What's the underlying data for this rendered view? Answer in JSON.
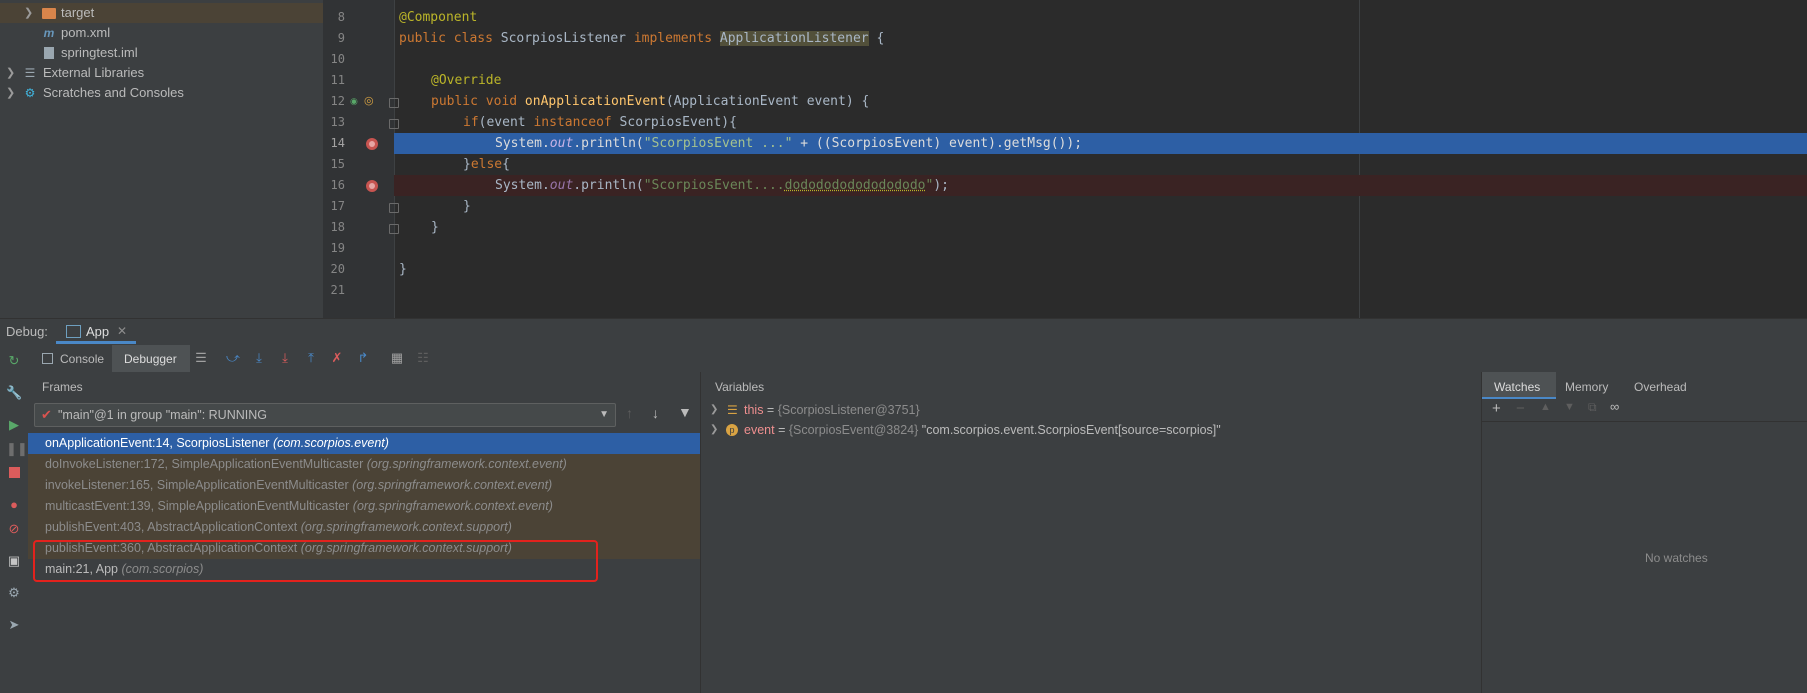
{
  "project_tree": {
    "items": [
      {
        "label": "target",
        "icon": "folder-icon"
      },
      {
        "label": "pom.xml",
        "icon": "maven-icon"
      },
      {
        "label": "springtest.iml",
        "icon": "file-icon"
      },
      {
        "label": "External Libraries",
        "icon": "libraries-icon"
      },
      {
        "label": "Scratches and Consoles",
        "icon": "scratches-icon"
      }
    ]
  },
  "editor": {
    "line_numbers": [
      "8",
      "9",
      "10",
      "11",
      "12",
      "13",
      "14",
      "15",
      "16",
      "17",
      "18",
      "19",
      "20",
      "21"
    ],
    "lines": {
      "l8": {
        "annotation": "@Component"
      },
      "l9": {
        "kw1": "public class ",
        "cls": "ScorpiosListener ",
        "kw2": "implements ",
        "iface": "ApplicationListener",
        "rest": " {"
      },
      "l11": {
        "annotation": "@Override"
      },
      "l12": {
        "kw1": "public void ",
        "fn": "onApplicationEvent",
        "rest": "(ApplicationEvent event) {"
      },
      "l13": {
        "kw1": "if",
        "rest1": "(event ",
        "kw2": "instanceof",
        "rest2": " ScorpiosEvent){"
      },
      "l14": {
        "pre": "System.",
        "fld": "out",
        "mid": ".println(",
        "str": "\"ScorpiosEvent ...\"",
        "post": " + ((ScorpiosEvent) event).getMsg());"
      },
      "l15": {
        "pre": "}",
        "kw": "else",
        "post": "{"
      },
      "l16": {
        "pre": "System.",
        "fld": "out",
        "mid": ".println(",
        "str1": "\"ScorpiosEvent....",
        "str2": "dododododododododo",
        "str3": "\"",
        "post": ");"
      },
      "l17": {
        "text": "}"
      },
      "l18": {
        "text": "}"
      },
      "l20": {
        "text": "}"
      }
    }
  },
  "debug": {
    "label": "Debug:",
    "session_tab": "App",
    "tabs": {
      "console": "Console",
      "debugger": "Debugger"
    },
    "frames_title": "Frames",
    "thread": "\"main\"@1 in group \"main\": RUNNING",
    "frames": [
      {
        "name": "onApplicationEvent:14, ScorpiosListener",
        "pkg": "(com.scorpios.event)"
      },
      {
        "name": "doInvokeListener:172, SimpleApplicationEventMulticaster",
        "pkg": "(org.springframework.context.event)"
      },
      {
        "name": "invokeListener:165, SimpleApplicationEventMulticaster",
        "pkg": "(org.springframework.context.event)"
      },
      {
        "name": "multicastEvent:139, SimpleApplicationEventMulticaster",
        "pkg": "(org.springframework.context.event)"
      },
      {
        "name": "publishEvent:403, AbstractApplicationContext",
        "pkg": "(org.springframework.context.support)"
      },
      {
        "name": "publishEvent:360, AbstractApplicationContext",
        "pkg": "(org.springframework.context.support)"
      },
      {
        "name": "main:21, App",
        "pkg": "(com.scorpios)"
      }
    ],
    "variables_title": "Variables",
    "variables": [
      {
        "name": "this",
        "eq": " = ",
        "value": "{ScorpiosListener@3751}",
        "extra": ""
      },
      {
        "name": "event",
        "eq": " = ",
        "value": "{ScorpiosEvent@3824}",
        "extra": " \"com.scorpios.event.ScorpiosEvent[source=scorpios]\""
      }
    ],
    "watches_tabs": {
      "watches": "Watches",
      "memory": "Memory",
      "overhead": "Overhead"
    },
    "no_watches": "No watches"
  },
  "colors": {
    "selection": "#2d5fa5",
    "breakpoint": "#c75450",
    "highlight_box": "#e3221d"
  }
}
